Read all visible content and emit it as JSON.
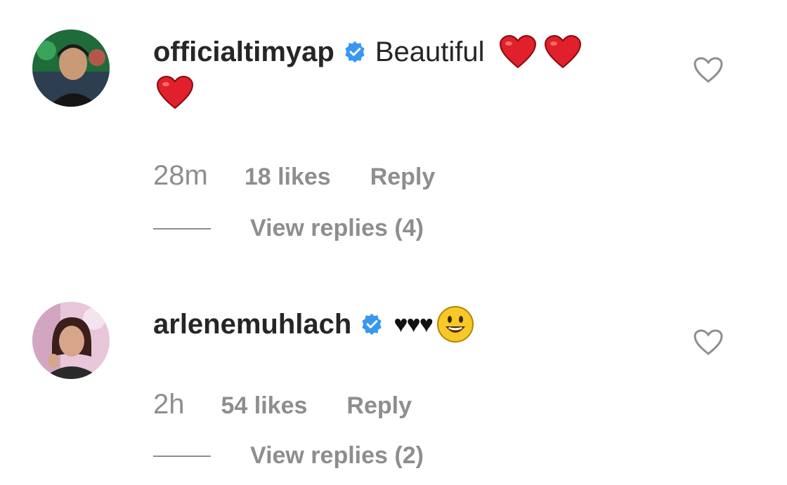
{
  "comments": [
    {
      "username": "officialtimyap",
      "verified": true,
      "text": "Beautiful",
      "emojis": [
        "red-heart",
        "red-heart",
        "red-heart"
      ],
      "time": "28m",
      "likes": "18 likes",
      "reply_label": "Reply",
      "view_replies": "View replies (4)"
    },
    {
      "username": "arlenemuhlach",
      "verified": true,
      "text": "♥♥♥",
      "emojis": [
        "smiley-face"
      ],
      "time": "2h",
      "likes": "54 likes",
      "reply_label": "Reply",
      "view_replies": "View replies (2)"
    }
  ],
  "colors": {
    "verified_badge": "#3897f0",
    "meta_text": "#8e8e8e",
    "username_text": "#262626",
    "heart_emoji": "#e0202a"
  }
}
